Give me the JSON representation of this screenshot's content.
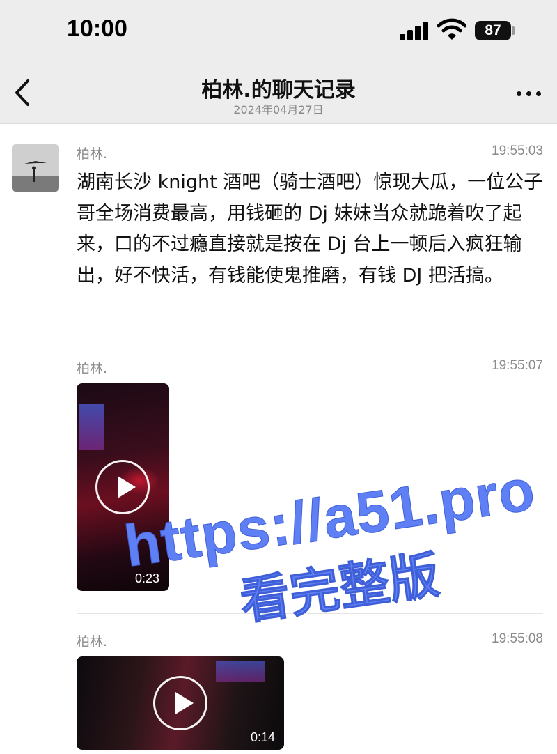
{
  "status_bar": {
    "time": "10:00",
    "battery": "87"
  },
  "nav": {
    "title": "柏林.的聊天记录",
    "subtitle": "2024年04月27日"
  },
  "messages": [
    {
      "sender": "柏林.",
      "time": "19:55:03",
      "type": "text",
      "text": "湖南长沙 knight 酒吧（骑士酒吧）惊现大瓜，一位公子哥全场消费最高，用钱砸的 Dj 妹妹当众就跪着吹了起来，口的不过瘾直接就是按在 Dj 台上一顿后入疯狂输出，好不快活，有钱能使鬼推磨，有钱 DJ 把活搞。"
    },
    {
      "sender": "柏林.",
      "time": "19:55:07",
      "type": "video",
      "duration": "0:23"
    },
    {
      "sender": "柏林.",
      "time": "19:55:08",
      "type": "video",
      "duration": "0:14"
    }
  ],
  "watermark": {
    "line1": "https://a51.pro",
    "line2": "看完整版",
    "color": "#5f7ff4"
  },
  "colors": {
    "header_bg": "#ededed",
    "meta_text": "#8a8a8a"
  },
  "icons": {
    "back": "chevron-left-icon",
    "more": "more-dots-icon",
    "play": "play-icon",
    "signal": "signal-icon",
    "wifi": "wifi-icon",
    "battery": "battery-icon"
  }
}
